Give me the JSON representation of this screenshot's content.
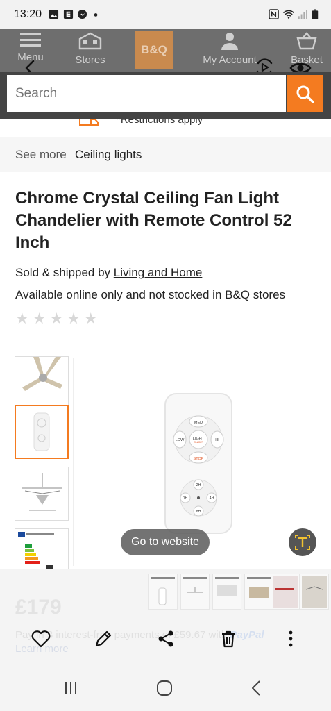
{
  "status_bar": {
    "time": "13:20"
  },
  "header": {
    "menu_label": "Menu",
    "stores_label": "Stores",
    "logo_text": "B&Q",
    "account_label": "My Account",
    "basket_label": "Basket"
  },
  "search": {
    "placeholder": "Search"
  },
  "restrictions": {
    "text": "*Restrictions apply"
  },
  "breadcrumb": {
    "prefix": "See more",
    "link": "Ceiling lights"
  },
  "product": {
    "title": "Chrome Crystal Ceiling Fan Light Chandelier with Remote Control 52 Inch",
    "sold_by_prefix": "Sold & shipped by",
    "seller": "Living and Home",
    "availability": "Available online only and not stocked in B&Q stores",
    "rating_stars": "★★★★★",
    "price": "£179",
    "paypal_text": "Pay in 3 interest-free payments of £59.67 with",
    "paypal_brand": "PayPal",
    "learn_more": "Learn more"
  },
  "remote": {
    "med": "MED",
    "low": "LOW",
    "light": "LIGHT",
    "light_sub": "ON/OFF",
    "hi": "HI",
    "stop": "STOP",
    "t2": "2H",
    "t1": "1H",
    "t4": "4H",
    "t8": "8H"
  },
  "lens_overlay": {
    "go_to_website": "Go to website"
  },
  "colors": {
    "accent_orange": "#f47b20",
    "header_gray": "#6e6e6e"
  }
}
